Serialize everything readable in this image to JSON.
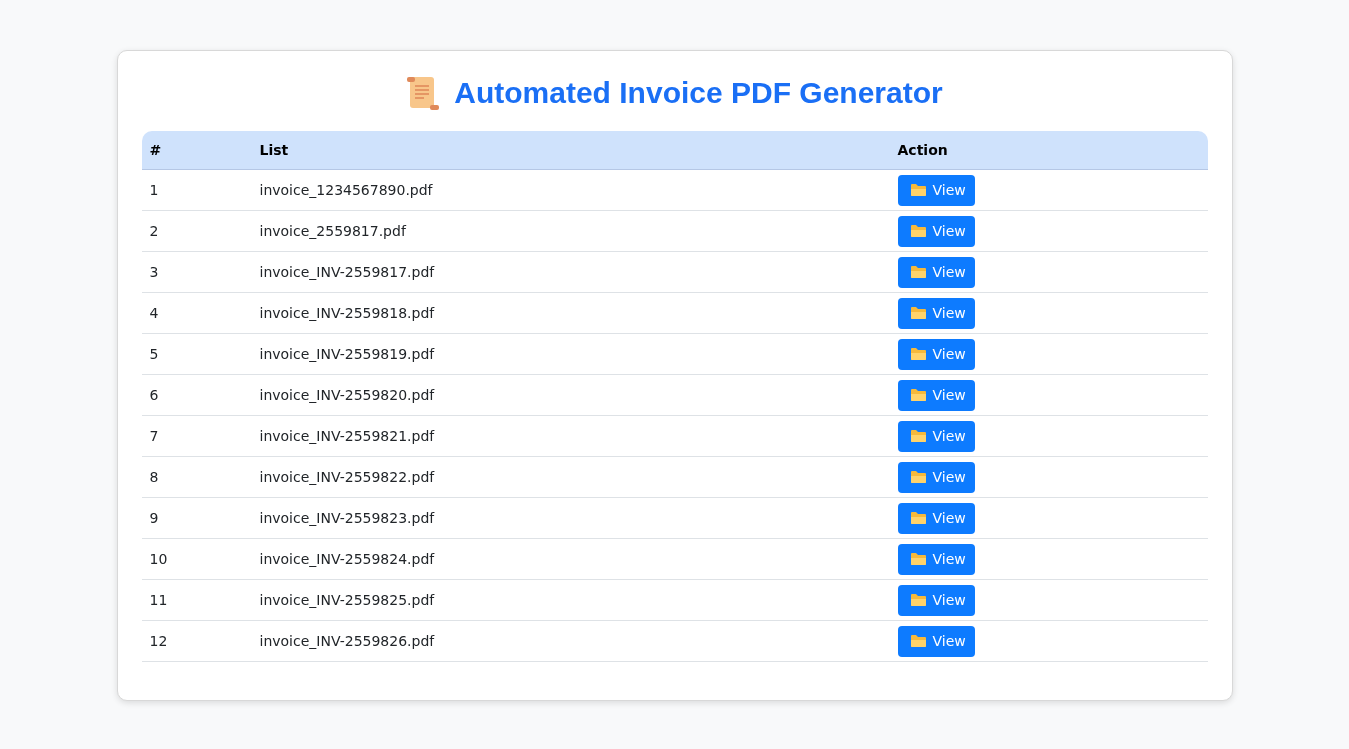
{
  "title": "Automated Invoice PDF Generator",
  "table": {
    "columns": [
      "#",
      "List",
      "Action"
    ],
    "rows": [
      {
        "number": "1",
        "file": "invoice_1234567890.pdf",
        "action": "View"
      },
      {
        "number": "2",
        "file": "invoice_2559817.pdf",
        "action": "View"
      },
      {
        "number": "3",
        "file": "invoice_INV-2559817.pdf",
        "action": "View"
      },
      {
        "number": "4",
        "file": "invoice_INV-2559818.pdf",
        "action": "View"
      },
      {
        "number": "5",
        "file": "invoice_INV-2559819.pdf",
        "action": "View"
      },
      {
        "number": "6",
        "file": "invoice_INV-2559820.pdf",
        "action": "View"
      },
      {
        "number": "7",
        "file": "invoice_INV-2559821.pdf",
        "action": "View"
      },
      {
        "number": "8",
        "file": "invoice_INV-2559822.pdf",
        "action": "View"
      },
      {
        "number": "9",
        "file": "invoice_INV-2559823.pdf",
        "action": "View"
      },
      {
        "number": "10",
        "file": "invoice_INV-2559824.pdf",
        "action": "View"
      },
      {
        "number": "11",
        "file": "invoice_INV-2559825.pdf",
        "action": "View"
      },
      {
        "number": "12",
        "file": "invoice_INV-2559826.pdf",
        "action": "View"
      }
    ]
  }
}
